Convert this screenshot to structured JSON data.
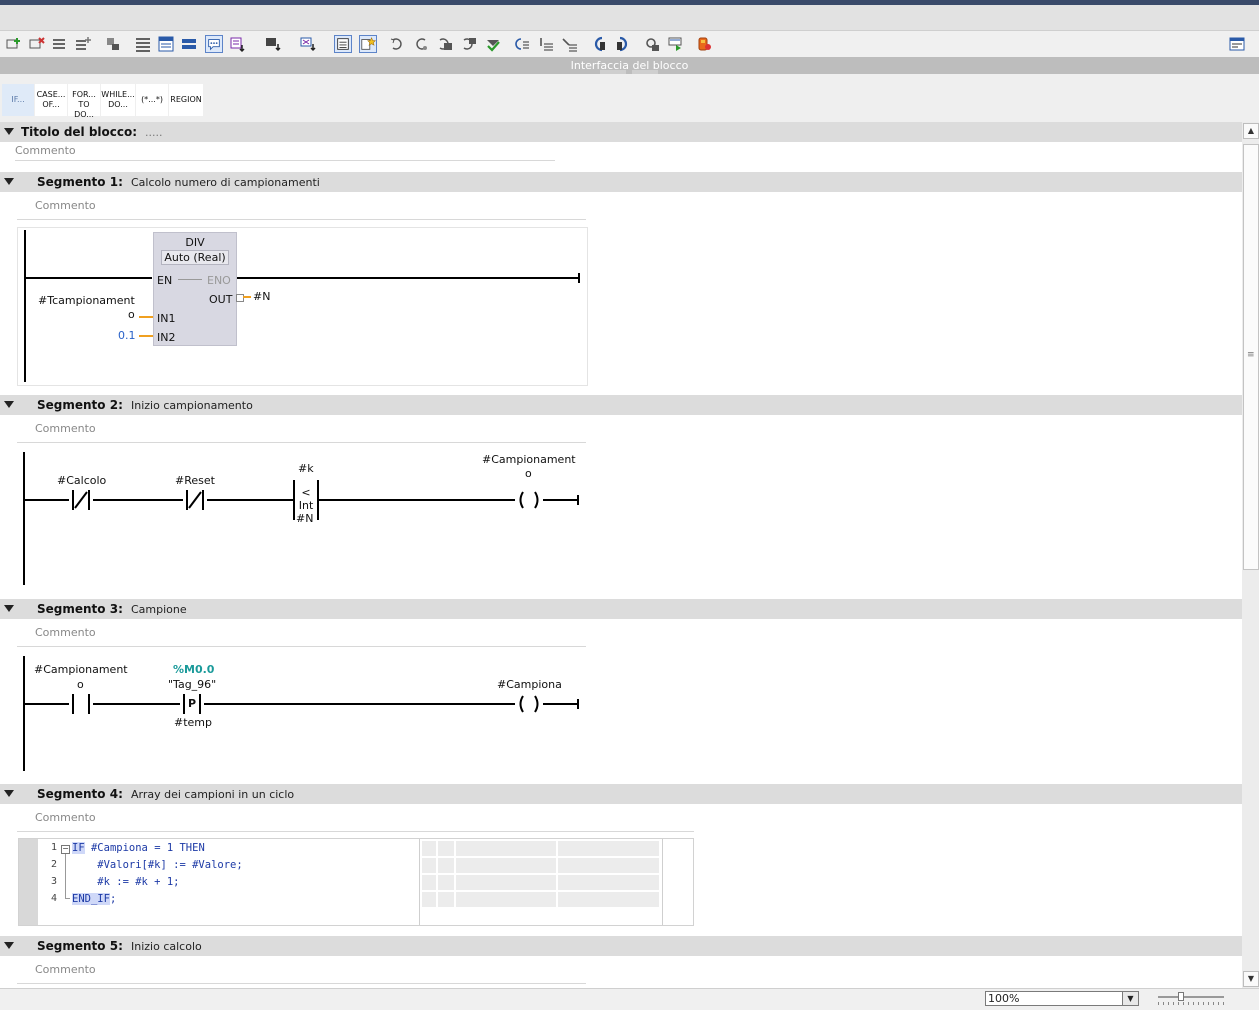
{
  "interface_bar": {
    "label": "Interfaccia del blocco"
  },
  "snippets": [
    {
      "l1": "IF...",
      "l2": ""
    },
    {
      "l1": "CASE...",
      "l2": "OF..."
    },
    {
      "l1": "FOR...",
      "l2": "TO DO..."
    },
    {
      "l1": "WHILE...",
      "l2": "DO..."
    },
    {
      "l1": "(*...*)",
      "l2": ""
    },
    {
      "l1": "REGION",
      "l2": ""
    }
  ],
  "block": {
    "title_label": "Titolo del blocco:",
    "title_value": ".....",
    "comment": "Commento"
  },
  "segments": [
    {
      "name": "Segmento 1:",
      "desc": "Calcolo numero di campionamenti",
      "comment": "Commento",
      "div": {
        "title": "DIV",
        "type": "Auto (Real)",
        "en": "EN",
        "eno": "ENO",
        "out": "OUT",
        "in1": "IN1",
        "in2": "IN2"
      },
      "in1_operand_a": "#Tcampionament",
      "in1_operand_b": "o",
      "in2_operand": "0.1",
      "out_operand": "#N"
    },
    {
      "name": "Segmento 2:",
      "desc": "Inizio campionamento",
      "comment": "Commento",
      "contact1": "#Calcolo",
      "contact2": "#Reset",
      "cmp_top": "#k",
      "cmp_op": "<",
      "cmp_type": "Int",
      "cmp_bottom": "#N",
      "coil_a": "#Campionament",
      "coil_b": "o"
    },
    {
      "name": "Segmento 3:",
      "desc": "Campione",
      "comment": "Commento",
      "contact_a": "#Campionament",
      "contact_b": "o",
      "p_addr": "%M0.0",
      "p_tag": "\"Tag_96\"",
      "p_label": "P",
      "p_bottom": "#temp",
      "coil": "#Campiona"
    },
    {
      "name": "Segmento 4:",
      "desc": "Array dei campioni in un ciclo",
      "comment": "Commento",
      "code": {
        "numbers": [
          "1",
          "2",
          "3",
          "4"
        ],
        "l1_kw": "IF",
        "l1_rest": " #Campiona = 1 THEN",
        "l2": "    #Valori[#k] := #Valore;",
        "l3": "    #k := #k + 1;",
        "l4_kw": "END_IF",
        "l4_rest": ";"
      }
    },
    {
      "name": "Segmento 5:",
      "desc": "Inizio calcolo",
      "comment": "Commento"
    }
  ],
  "status": {
    "zoom": "100%"
  },
  "colors": {
    "wire_orange": "#f0a020",
    "keyword_blue": "#1d3aa6",
    "address_teal": "#1a9a9a",
    "constant_blue": "#2a62c8"
  }
}
